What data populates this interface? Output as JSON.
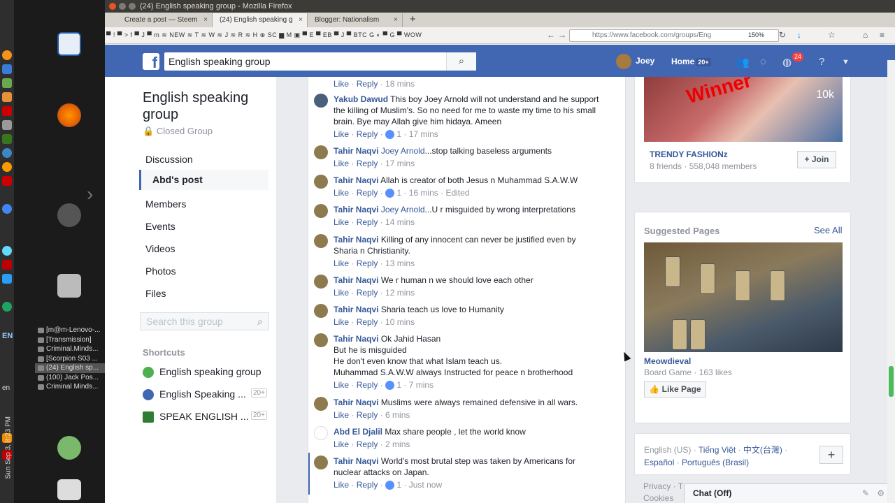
{
  "window": {
    "title": "(24) English speaking group - Mozilla Firefox"
  },
  "tabs": [
    {
      "label": "Create a post — Steem"
    },
    {
      "label": "(24) English speaking g"
    },
    {
      "label": "Blogger: Nationalism"
    }
  ],
  "navbar": {
    "bookmarks": "▀ ! ▀ > f  ▀ J ▀ m ≋ NEW ≋ T ≋ W ≋ J ≋ R ≋ H ⊕ SC ▆ M ▣ ▀ E ▀ EB ▀ J ▀ BTC G ◐ ▀ G ▀ WOW",
    "url": "https://www.facebook.com/groups/Eng",
    "zoom": "150%"
  },
  "fb_header": {
    "search_value": "English speaking group",
    "user_name": "Joey",
    "home_label": "Home",
    "home_badge": "20+",
    "notif_count": "24"
  },
  "left": {
    "group_title": "English speaking group",
    "group_type": "Closed Group",
    "nav": [
      "Discussion",
      "Abd's post",
      "Members",
      "Events",
      "Videos",
      "Photos",
      "Files"
    ],
    "search_placeholder": "Search this group",
    "shortcuts_heading": "Shortcuts",
    "shortcuts": [
      {
        "label": "English speaking group",
        "badge": ""
      },
      {
        "label": "English Speaking ...",
        "badge": "20+"
      },
      {
        "label": "SPEAK ENGLISH ...",
        "badge": "20+"
      }
    ]
  },
  "comments": [
    {
      "name": "",
      "text": "",
      "like_label": "Like",
      "reply_label": "Reply",
      "reactions": "",
      "time": "18 mins",
      "edited": ""
    },
    {
      "name": "Yakub Dawud",
      "text": "This boy Joey Arnold will not understand and he support the killing of Muslim's. So no need for me to waste my time to his small brain. Bye may Allah give him hidaya. Ameen",
      "like_label": "Like",
      "reply_label": "Reply",
      "reactions": "1",
      "time": "17 mins",
      "edited": ""
    },
    {
      "name": "Tahir Naqvi",
      "mention": "Joey Arnold",
      "text": "...stop talking baseless arguments",
      "like_label": "Like",
      "reply_label": "Reply",
      "reactions": "",
      "time": "17 mins",
      "edited": ""
    },
    {
      "name": "Tahir Naqvi",
      "text": "Allah is creator of both Jesus n Muhammad S.A.W.W",
      "like_label": "Like",
      "reply_label": "Reply",
      "reactions": "1",
      "time": "16 mins",
      "edited": "Edited"
    },
    {
      "name": "Tahir Naqvi",
      "mention": "Joey Arnold",
      "text": "...U r misguided by wrong interpretations",
      "like_label": "Like",
      "reply_label": "Reply",
      "reactions": "",
      "time": "14 mins",
      "edited": ""
    },
    {
      "name": "Tahir Naqvi",
      "text": "Killing of any innocent can never be justified even by Sharia n Christianity.",
      "like_label": "Like",
      "reply_label": "Reply",
      "reactions": "",
      "time": "13 mins",
      "edited": ""
    },
    {
      "name": "Tahir Naqvi",
      "text": "We r human n we should love each other",
      "like_label": "Like",
      "reply_label": "Reply",
      "reactions": "",
      "time": "12 mins",
      "edited": ""
    },
    {
      "name": "Tahir Naqvi",
      "text": "Sharia teach us love to Humanity",
      "like_label": "Like",
      "reply_label": "Reply",
      "reactions": "",
      "time": "10 mins",
      "edited": ""
    },
    {
      "name": "Tahir Naqvi",
      "text": "Ok Jahid Hasan",
      "lines": [
        "But he is misguided",
        "He don't even know that what Islam teach us.",
        "Muhammad S.A.W.W always Instructed for peace n brotherhood"
      ],
      "like_label": "Like",
      "reply_label": "Reply",
      "reactions": "1",
      "time": "7 mins",
      "edited": ""
    },
    {
      "name": "Tahir Naqvi",
      "text": "Muslims were always remained defensive in all wars.",
      "like_label": "Like",
      "reply_label": "Reply",
      "reactions": "",
      "time": "6 mins",
      "edited": ""
    },
    {
      "name": "Abd El Djalil",
      "text": "Max share people , let the world know",
      "like_label": "Like",
      "reply_label": "Reply",
      "reactions": "",
      "time": "2 mins",
      "edited": ""
    },
    {
      "name": "Tahir Naqvi",
      "text": "World's most brutal step was taken by Americans for nuclear attacks on Japan.",
      "like_label": "Like",
      "reply_label": "Reply",
      "reactions": "1",
      "time": "Just now",
      "edited": ""
    }
  ],
  "right": {
    "trend_overlay": "Winner",
    "trend_count": "10k",
    "trend_name": "TRENDY FASHIONz",
    "trend_meta": "8 friends · 558,048 members",
    "join_label": "Join",
    "suggested_title": "Suggested Pages",
    "see_all": "See All",
    "page_name": "Meowdieval",
    "page_meta": "Board Game · 163 likes",
    "like_page_label": "Like Page",
    "lang_current": "English (US)",
    "langs": [
      "Tiếng Việt",
      "中文(台灣)",
      "Español",
      "Português (Brasil)"
    ],
    "footer": [
      "Privacy · T",
      "Cookies"
    ]
  },
  "chat": {
    "label": "Chat (Off)"
  },
  "desktop": {
    "lang": "EN",
    "lang2": "en",
    "clock": "Sun Sep 3, 8:23 PM",
    "taskmenu": [
      "[m@m-Lenovo-...",
      "[Transmission]",
      "Criminal.Minds...",
      "[Scorpion S03 ...",
      "(24) English sp...",
      "(100) Jack Pos...",
      "Criminal Minds..."
    ]
  }
}
